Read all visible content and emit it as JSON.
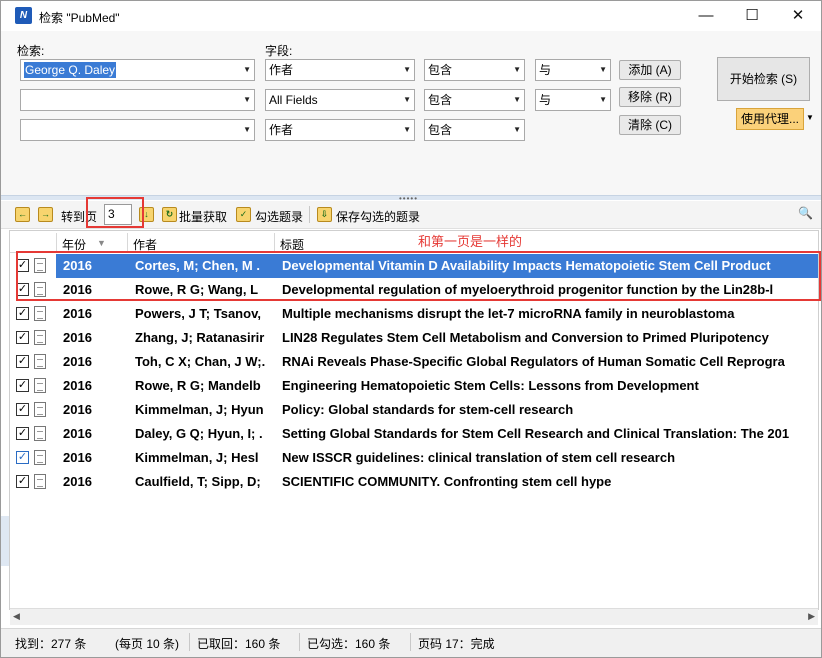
{
  "window": {
    "title": "检索 \"PubMed\"",
    "app_icon": "app-icon"
  },
  "search": {
    "search_label": "检索:",
    "field_label": "字段:",
    "rows": [
      {
        "term": "George Q. Daley",
        "field": "作者",
        "op": "包含",
        "logic": "与"
      },
      {
        "term": "",
        "field": "All Fields",
        "op": "包含",
        "logic": "与"
      },
      {
        "term": "",
        "field": "作者",
        "op": "包含",
        "logic": ""
      }
    ],
    "add_label": "添加 (A)",
    "remove_label": "移除 (R)",
    "clear_label": "清除 (C)",
    "start_label": "开始检索 (S)",
    "proxy_label": "使用代理..."
  },
  "toolbar": {
    "goto_label": "转到页",
    "page_value": "3",
    "batch_label": "批量获取",
    "check_label": "勾选题录",
    "save_label": "保存勾选的题录"
  },
  "annotation": "和第一页是一样的",
  "columns": {
    "year": "年份",
    "author": "作者",
    "title": "标题"
  },
  "rows": [
    {
      "checked": true,
      "year": "2016",
      "author": "Cortes, M; Chen, M .",
      "title": "Developmental Vitamin D Availability Impacts Hematopoietic Stem Cell Product"
    },
    {
      "checked": true,
      "year": "2016",
      "author": "Rowe, R G; Wang, L",
      "title": "Developmental regulation of myeloerythroid progenitor function by the Lin28b-l"
    },
    {
      "checked": true,
      "year": "2016",
      "author": "Powers, J T; Tsanov,",
      "title": "Multiple mechanisms disrupt the let-7 microRNA family in neuroblastoma"
    },
    {
      "checked": true,
      "year": "2016",
      "author": "Zhang, J; Ratanasirir",
      "title": "LIN28 Regulates Stem Cell Metabolism and Conversion to Primed Pluripotency"
    },
    {
      "checked": true,
      "year": "2016",
      "author": "Toh, C X; Chan, J W;.",
      "title": "RNAi Reveals Phase-Specific Global Regulators of Human Somatic Cell Reprogra"
    },
    {
      "checked": true,
      "year": "2016",
      "author": "Rowe, R G; Mandelb",
      "title": "Engineering Hematopoietic Stem Cells: Lessons from Development"
    },
    {
      "checked": true,
      "year": "2016",
      "author": "Kimmelman, J; Hyun",
      "title": "Policy: Global standards for stem-cell research"
    },
    {
      "checked": true,
      "year": "2016",
      "author": "Daley, G Q; Hyun, I; .",
      "title": "Setting Global Standards for Stem Cell Research and Clinical Translation: The 201"
    },
    {
      "checked": true,
      "year": "2016",
      "author": "Kimmelman, J; Hesl",
      "title": "New ISSCR guidelines: clinical translation of stem cell research"
    },
    {
      "checked": true,
      "year": "2016",
      "author": "Caulfield, T; Sipp, D;",
      "title": "SCIENTIFIC COMMUNITY. Confronting stem cell hype"
    }
  ],
  "status": {
    "found": "找到：277 条",
    "per_page": "(每页 10 条)",
    "fetched": "已取回：160 条",
    "checked": "已勾选：160 条",
    "page": "页码 17：完成"
  }
}
